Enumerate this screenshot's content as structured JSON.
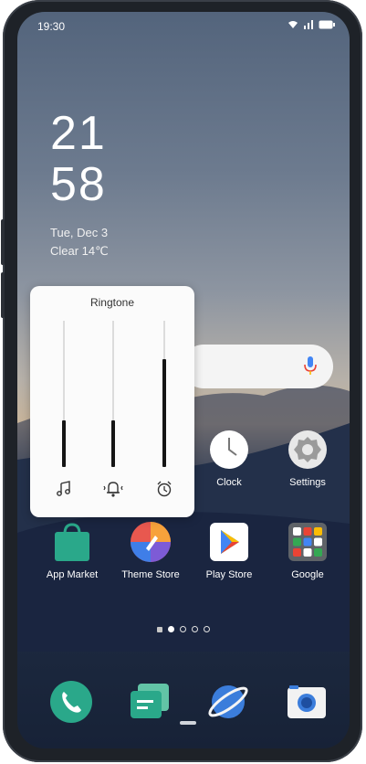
{
  "status_bar": {
    "time": "19:30"
  },
  "clock_widget": {
    "hour": "21",
    "minute": "58",
    "date": "Tue, Dec 3",
    "weather": "Clear 14℃"
  },
  "search_widget": {
    "icon": "mic-icon"
  },
  "volume_panel": {
    "title": "Ringtone",
    "sliders": [
      {
        "icon": "music-note-icon",
        "level": 0.32
      },
      {
        "icon": "vibrate-bell-icon",
        "level": 0.32
      },
      {
        "icon": "alarm-clock-icon",
        "level": 0.74
      }
    ]
  },
  "apps_row1": [
    {
      "label": "Clock",
      "icon": "clock-icon"
    },
    {
      "label": "Settings",
      "icon": "gear-icon"
    }
  ],
  "apps_row2": [
    {
      "label": "App Market",
      "icon": "shopping-bag-icon",
      "color": "#2aa88a"
    },
    {
      "label": "Theme Store",
      "icon": "theme-brush-icon",
      "color": "#e8584f"
    },
    {
      "label": "Play Store",
      "icon": "play-store-icon",
      "color": "#ffffff"
    },
    {
      "label": "Google",
      "icon": "google-folder-icon",
      "color": "#5f6368"
    }
  ],
  "page_indicator": {
    "pages": 4,
    "active": 0
  },
  "dock": [
    {
      "icon": "phone-icon",
      "color": "#2aa88a"
    },
    {
      "icon": "messages-icon",
      "color": "#3fae8f"
    },
    {
      "icon": "browser-planet-icon",
      "color": "#3b7ddb"
    },
    {
      "icon": "camera-icon",
      "color": "#ffffff"
    }
  ]
}
